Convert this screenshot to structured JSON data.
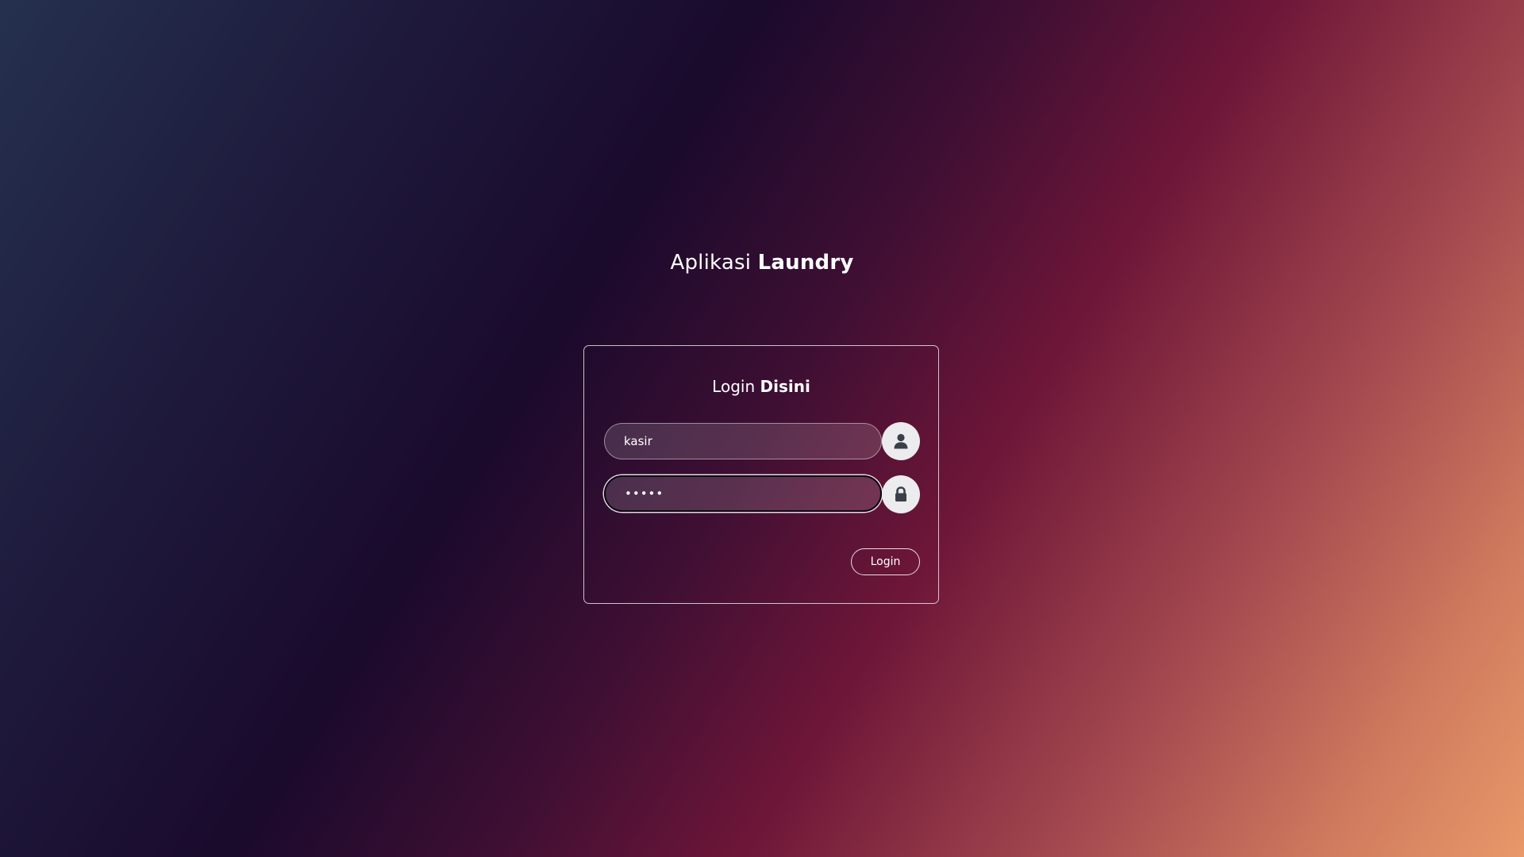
{
  "app_title": {
    "regular": "Aplikasi",
    "bold": "Laundry"
  },
  "login_card": {
    "title_regular": "Login",
    "title_bold": "Disini",
    "username": {
      "value": "kasir",
      "icon": "user-icon"
    },
    "password": {
      "value": "•••••",
      "icon": "lock-icon"
    },
    "submit_label": "Login"
  },
  "colors": {
    "background_start": "#25304f",
    "background_mid": "#1a0a2c",
    "background_accent": "#6e1638",
    "background_end": "#e89869",
    "icon_circle": "#ececef",
    "icon_glyph": "#3a3f4a"
  }
}
